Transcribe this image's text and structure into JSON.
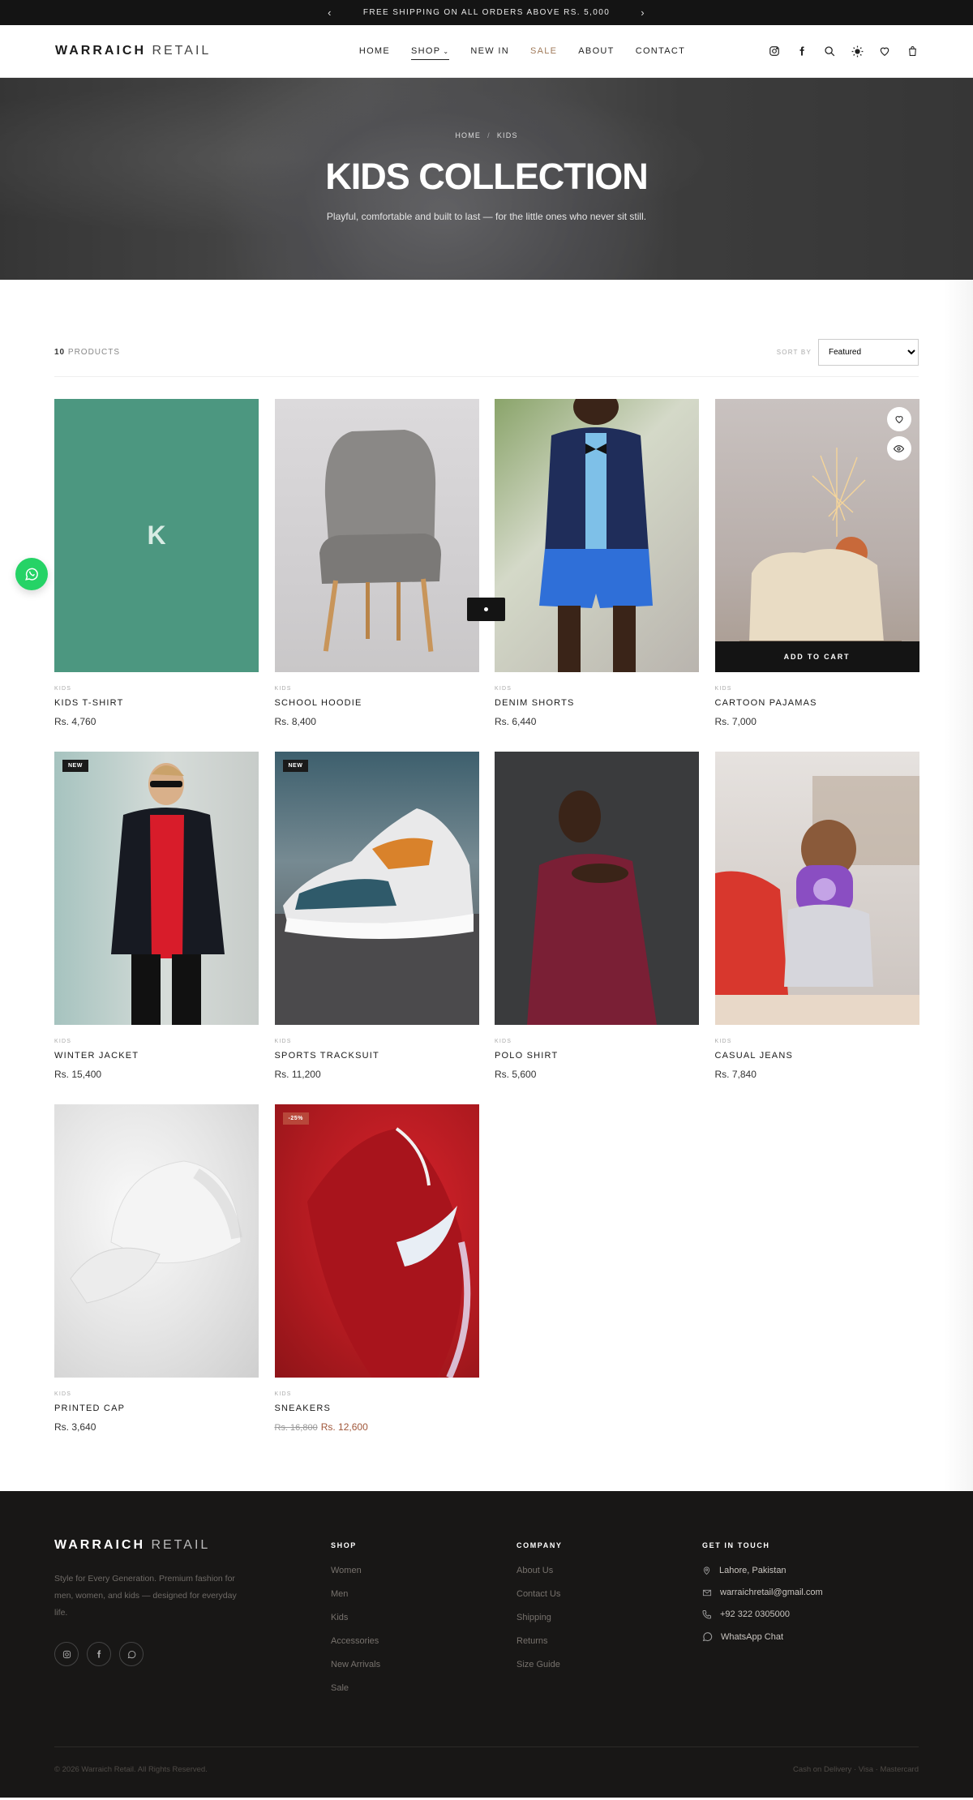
{
  "announcement": {
    "text": "FREE SHIPPING ON ALL ORDERS ABOVE RS. 5,000"
  },
  "brand": {
    "name_bold": "WARRAICH",
    "name_light": "RETAIL"
  },
  "nav": {
    "home": "HOME",
    "shop": "SHOP",
    "new_in": "NEW IN",
    "sale": "SALE",
    "about": "ABOUT",
    "contact": "CONTACT"
  },
  "hero": {
    "crumb_home": "HOME",
    "crumb_sep": "/",
    "crumb_current": "KIDS",
    "title": "KIDS COLLECTION",
    "subtitle": "Playful, comfortable and built to last — for the little ones who never sit still."
  },
  "toolbar": {
    "count": "10",
    "count_label": "PRODUCTS",
    "sort_label": "SORT BY",
    "sort_value": "Featured"
  },
  "add_to_cart": "ADD TO CART",
  "products": [
    {
      "category": "KIDS",
      "name": "KIDS T-SHIRT",
      "price": "Rs. 4,760",
      "placeholder": "K"
    },
    {
      "category": "KIDS",
      "name": "SCHOOL HOODIE",
      "price": "Rs. 8,400"
    },
    {
      "category": "KIDS",
      "name": "DENIM SHORTS",
      "price": "Rs. 6,440"
    },
    {
      "category": "KIDS",
      "name": "CARTOON PAJAMAS",
      "price": "Rs. 7,000"
    },
    {
      "category": "KIDS",
      "name": "WINTER JACKET",
      "price": "Rs. 15,400",
      "badge": "NEW"
    },
    {
      "category": "KIDS",
      "name": "SPORTS TRACKSUIT",
      "price": "Rs. 11,200",
      "badge": "NEW"
    },
    {
      "category": "KIDS",
      "name": "POLO SHIRT",
      "price": "Rs. 5,600"
    },
    {
      "category": "KIDS",
      "name": "CASUAL JEANS",
      "price": "Rs. 7,840"
    },
    {
      "category": "KIDS",
      "name": "PRINTED CAP",
      "price": "Rs. 3,640"
    },
    {
      "category": "KIDS",
      "name": "SNEAKERS",
      "old_price": "Rs. 16,800",
      "price": "Rs. 12,600",
      "badge": "-25%"
    }
  ],
  "footer": {
    "description": "Style for Every Generation. Premium fashion for men, women, and kids — designed for everyday life.",
    "shop_title": "SHOP",
    "shop_links": [
      "Women",
      "Men",
      "Kids",
      "Accessories",
      "New Arrivals",
      "Sale"
    ],
    "company_title": "COMPANY",
    "company_links": [
      "About Us",
      "Contact Us",
      "Shipping",
      "Returns",
      "Size Guide"
    ],
    "contact_title": "GET IN TOUCH",
    "location": "Lahore, Pakistan",
    "email": "warraichretail@gmail.com",
    "phone": "+92 322 0305000",
    "whatsapp": "WhatsApp Chat",
    "copyright": "© 2026 Warraich Retail. All Rights Reserved.",
    "payments": "Cash on Delivery · Visa · Mastercard"
  },
  "colors": {
    "accent_sale": "#b8473a",
    "whatsapp": "#25d366",
    "dark": "#141414"
  }
}
